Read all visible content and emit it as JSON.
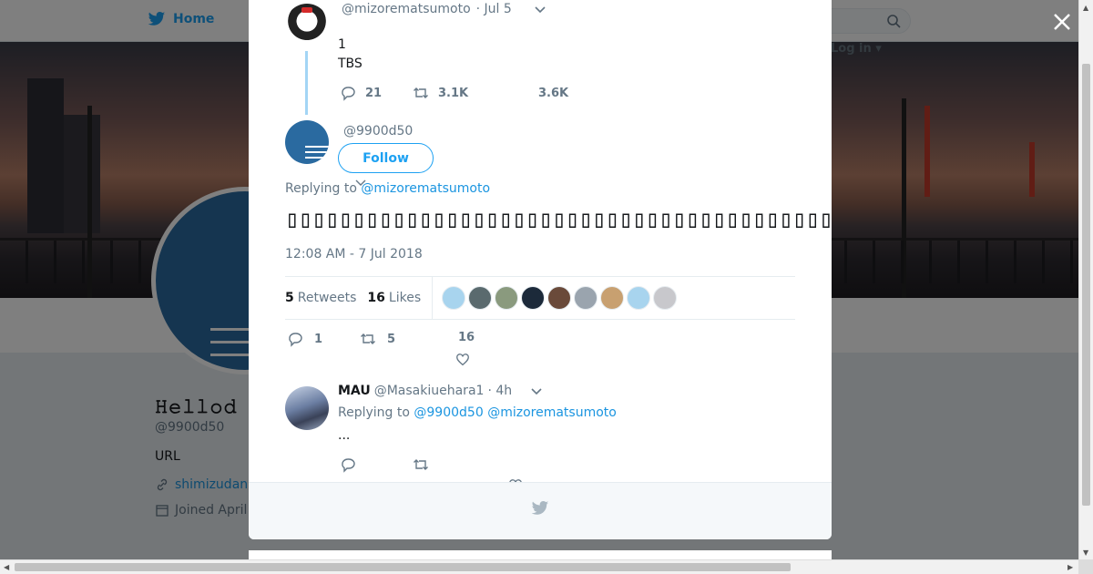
{
  "background": {
    "home_label": "Home",
    "login_label": "Log in",
    "profile_name": "𝙷𝚎𝚕𝚕𝚘𝚍",
    "profile_handle": "@9900d50",
    "url_label": "URL",
    "link_text": "shimizudan",
    "joined_text": "Joined April"
  },
  "ancestor_tweet": {
    "handle": "@mizorematsumoto",
    "time": "· Jul 5",
    "line1": "1",
    "line2": "TBS",
    "replies": "21",
    "retweets": "3.1K",
    "likes": "3.6K"
  },
  "main_tweet": {
    "handle": "@9900d50",
    "follow_label": "Follow",
    "replying_prefix": "Replying to",
    "replying_handle": "@mizorematsumoto",
    "text": "▯▯▯▯▯▯▯▯▯▯▯▯▯▯▯▯▯▯▯▯▯▯▯▯▯▯▯▯▯▯▯▯▯▯▯▯▯▯▯▯▯▯▯▯▯▯▯▯▯▯▯▯▯",
    "timestamp": "12:08 AM - 7 Jul 2018",
    "retweets_count": "5",
    "retweets_label": "Retweets",
    "likes_count": "16",
    "likes_label": "Likes",
    "reply_count": "1",
    "retweet_count": "5",
    "like_count": "16",
    "liker_colors": [
      "#a8d4ee",
      "#5a6a6e",
      "#8a9a7e",
      "#1c2a3a",
      "#6a4a3a",
      "#9aa4ae",
      "#c8a070",
      "#a8d4ee",
      "#c8c8cc"
    ]
  },
  "reply_tweet": {
    "name": "MAU",
    "handle": "@Masakiuehara1",
    "time": "· 4h",
    "replying_prefix": "Replying to",
    "replying_handle1": "@9900d50",
    "replying_handle2": "@mizorematsumoto",
    "text": "..."
  },
  "colors": {
    "accent": "#1da1f2",
    "link": "#1b95e0",
    "muted": "#657786"
  }
}
